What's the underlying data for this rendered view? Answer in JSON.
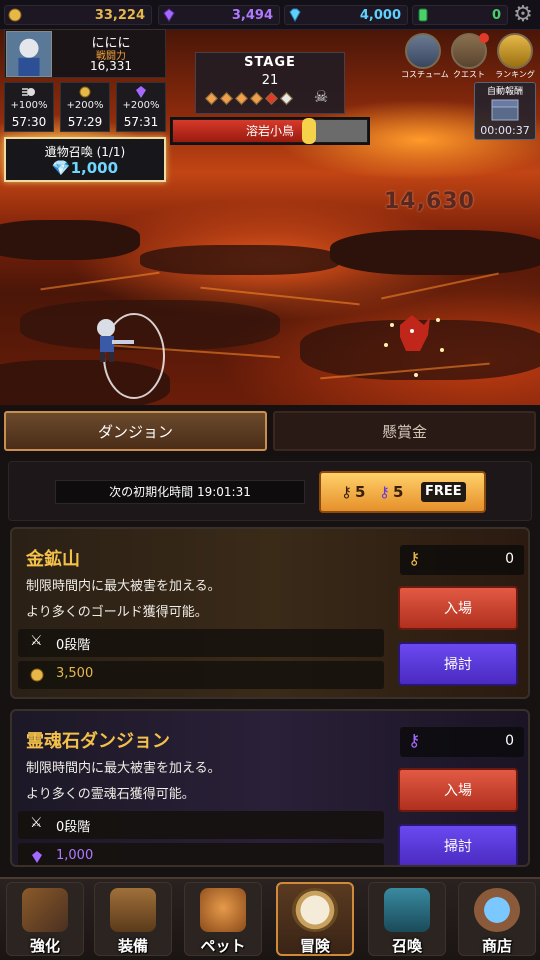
{
  "currencies": [
    {
      "name": "gold",
      "icon": "gold-coin-icon",
      "value": "33,224",
      "color": "#e6b84a"
    },
    {
      "name": "soul-stone",
      "icon": "purple-gem-icon",
      "value": "3,494",
      "color": "#b07aff"
    },
    {
      "name": "diamond",
      "icon": "blue-diamond-icon",
      "value": "4,000",
      "color": "#5fd0ff"
    },
    {
      "name": "emerald",
      "icon": "green-gem-icon",
      "value": "0",
      "color": "#4ad06a"
    }
  ],
  "player": {
    "name": "ににに",
    "power_label": "戦闘力",
    "power": "16,331"
  },
  "buffs": [
    {
      "icon": "attack-buff-icon",
      "percent": "+100%",
      "time": "57:30"
    },
    {
      "icon": "gold-buff-icon",
      "percent": "+200%",
      "time": "57:29"
    },
    {
      "icon": "soul-buff-icon",
      "percent": "+200%",
      "time": "57:31"
    }
  ],
  "relic": {
    "label": "遺物召喚 (1/1)",
    "cost": "1,000"
  },
  "stage": {
    "label": "STAGE",
    "number": "21",
    "progress_filled": 5,
    "progress_total": 6
  },
  "enemy": {
    "name": "溶岩小鳥",
    "hp_fraction": 0.7
  },
  "side_menu": [
    {
      "icon": "costume-icon",
      "label": "コスチューム"
    },
    {
      "icon": "quest-icon",
      "label": "クエスト"
    },
    {
      "icon": "ranking-icon",
      "label": "ランキング"
    }
  ],
  "auto_reward": {
    "label": "自動報酬",
    "time": "00:00:37"
  },
  "damage_text": "14,630",
  "tabs": {
    "dungeon": "ダンジョン",
    "bounty": "懸賞金"
  },
  "reset": {
    "label": "次の初期化時間 19:01:31",
    "gold_keys": "5",
    "purple_keys": "5",
    "free": "FREE"
  },
  "dungeons": [
    {
      "title": "金鉱山",
      "desc1": "制限時間内に最大被害を加える。",
      "desc2": "より多くのゴールド獲得可能。",
      "floor": "0段階",
      "reward": "3,500",
      "keys": "0",
      "enter": "入場",
      "sweep": "掃討",
      "reward_color": "#e6b84a"
    },
    {
      "title": "霊魂石ダンジョン",
      "desc1": "制限時間内に最大被害を加える。",
      "desc2": "より多くの霊魂石獲得可能。",
      "floor": "0段階",
      "reward": "1,000",
      "keys": "0",
      "enter": "入場",
      "sweep": "掃討",
      "reward_color": "#b07aff"
    }
  ],
  "nav": [
    {
      "icon": "blunderbuss-icon",
      "label": "強化"
    },
    {
      "icon": "treasure-chest-icon",
      "label": "装備"
    },
    {
      "icon": "fox-pet-icon",
      "label": "ペット"
    },
    {
      "icon": "compass-icon",
      "label": "冒険"
    },
    {
      "icon": "summon-chest-icon",
      "label": "召喚"
    },
    {
      "icon": "gem-bag-icon",
      "label": "商店"
    }
  ]
}
